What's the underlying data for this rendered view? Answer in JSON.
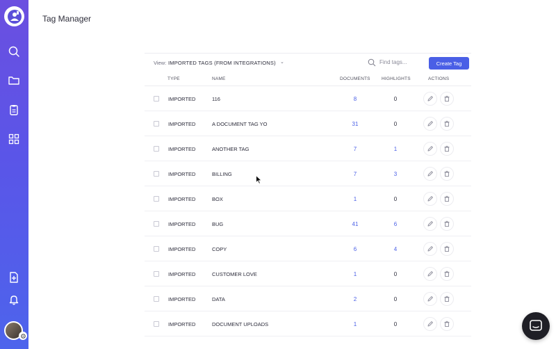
{
  "header": {
    "title": "Tag Manager"
  },
  "toolbar": {
    "view_label": "View:",
    "view_value": "IMPORTED TAGS (FROM INTEGRATIONS)",
    "search_placeholder": "Find tags...",
    "create_label": "Create Tag"
  },
  "columns": {
    "type": "TYPE",
    "name": "NAME",
    "documents": "DOCUMENTS",
    "highlights": "HIGHLIGHTS",
    "actions": "ACTIONS"
  },
  "rows": [
    {
      "type": "IMPORTED",
      "name": "116",
      "documents": "8",
      "highlights": "0"
    },
    {
      "type": "IMPORTED",
      "name": "A DOCUMENT TAG YO",
      "documents": "31",
      "highlights": "0"
    },
    {
      "type": "IMPORTED",
      "name": "ANOTHER TAG",
      "documents": "7",
      "highlights": "1"
    },
    {
      "type": "IMPORTED",
      "name": "BILLING",
      "documents": "7",
      "highlights": "3"
    },
    {
      "type": "IMPORTED",
      "name": "BOX",
      "documents": "1",
      "highlights": "0"
    },
    {
      "type": "IMPORTED",
      "name": "BUG",
      "documents": "41",
      "highlights": "6"
    },
    {
      "type": "IMPORTED",
      "name": "COPY",
      "documents": "6",
      "highlights": "4"
    },
    {
      "type": "IMPORTED",
      "name": "CUSTOMER LOVE",
      "documents": "1",
      "highlights": "0"
    },
    {
      "type": "IMPORTED",
      "name": "DATA",
      "documents": "2",
      "highlights": "0"
    },
    {
      "type": "IMPORTED",
      "name": "DOCUMENT UPLOADS",
      "documents": "1",
      "highlights": "0"
    }
  ],
  "icons": {
    "sidebar": [
      "search-icon",
      "folder-icon",
      "clipboard-icon",
      "dashboard-icon",
      "add-doc-icon",
      "bell-icon"
    ],
    "row_actions": [
      "edit-icon",
      "delete-icon"
    ]
  },
  "colors": {
    "accent": "#4a5fe6",
    "sidebar_top": "#6b4fe0",
    "sidebar_bottom": "#4d64ec",
    "chat_button": "#1f1f26"
  }
}
